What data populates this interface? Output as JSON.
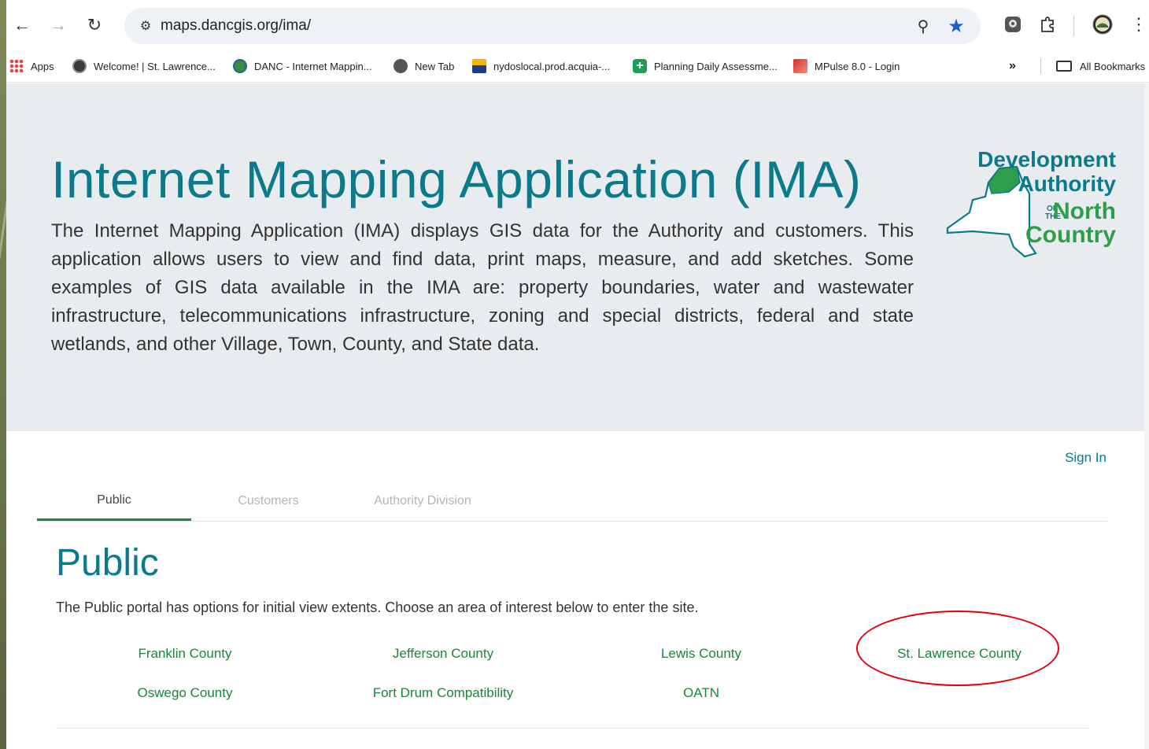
{
  "browser": {
    "url": "maps.dancgis.org/ima/",
    "bookmarks": [
      {
        "label": "Apps",
        "icon": "apps-grid-icon"
      },
      {
        "label": "Welcome! | St. Lawrence...",
        "icon": "county-seal-icon"
      },
      {
        "label": "DANC - Internet Mappin...",
        "icon": "globe-icon"
      },
      {
        "label": "New Tab",
        "icon": "new-tab-icon"
      },
      {
        "label": "nydoslocal.prod.acquia-...",
        "icon": "nydos-icon"
      },
      {
        "label": "Planning Daily Assessme...",
        "icon": "plus-icon"
      },
      {
        "label": "MPulse 8.0 - Login",
        "icon": "mpulse-icon"
      }
    ],
    "more_bookmarks": "»",
    "all_bookmarks": "All Bookmarks"
  },
  "hero": {
    "title": "Internet Mapping Application (IMA)",
    "description": "The Internet Mapping Application (IMA) displays GIS data for the Authority and customers. This application allows users to view and find data, print maps, measure, and add sketches. Some examples of GIS data available in the IMA are: property boundaries, water and wastewater infrastructure, telecommunications infrastructure, zoning and special districts, federal and state wetlands, and other Village, Town, County, and State data.",
    "logo": {
      "line1": "Development",
      "line2": "Authority",
      "of": "OF",
      "the": "THE",
      "line3": "North",
      "line4": "Country"
    }
  },
  "auth": {
    "sign_in": "Sign In"
  },
  "tabs": [
    {
      "label": "Public",
      "active": true
    },
    {
      "label": "Customers",
      "active": false
    },
    {
      "label": "Authority Division",
      "active": false
    }
  ],
  "public": {
    "title": "Public",
    "description": "The Public portal has options for initial view extents. Choose an area of interest below to enter the site.",
    "areas": [
      "Franklin County",
      "Jefferson County",
      "Lewis County",
      "St. Lawrence County",
      "Oswego County",
      "Fort Drum Compatibility",
      "OATN"
    ]
  },
  "colors": {
    "accent_teal": "#0b7a8a",
    "link_green": "#17873a",
    "tab_underline": "#1b8a3e",
    "highlight_red": "#e0000f",
    "hero_bg": "#e9ecef"
  }
}
